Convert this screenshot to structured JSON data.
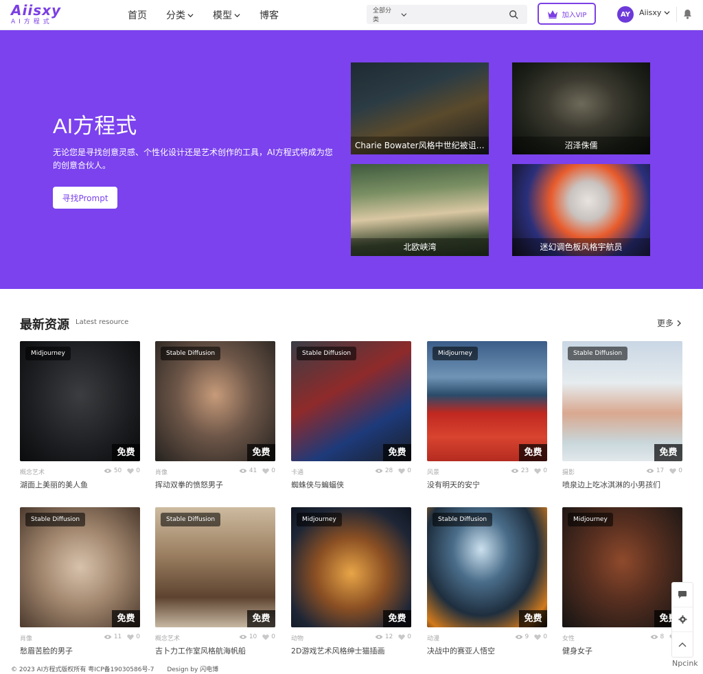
{
  "header": {
    "logo": {
      "main": "Aiisxy",
      "sub": "AI方程式"
    },
    "nav": [
      {
        "label": "首页",
        "has_dropdown": false
      },
      {
        "label": "分类",
        "has_dropdown": true
      },
      {
        "label": "模型",
        "has_dropdown": true
      },
      {
        "label": "博客",
        "has_dropdown": false
      }
    ],
    "search": {
      "category": "全部分类",
      "placeholder": ""
    },
    "vip_label": "加入VIP",
    "avatar_text": "AY",
    "username": "Aiisxy"
  },
  "hero": {
    "title": "AI方程式",
    "description": "无论您是寻找创意灵感、个性化设计还是艺术创作的工具，AI方程式将成为您的创意合伙人。",
    "button": "寻找Prompt",
    "features": [
      {
        "caption": "Charie Bowater风格中世纪被诅咒的哥特小镇"
      },
      {
        "caption": "沼泽侏儒"
      },
      {
        "caption": "北欧峡湾"
      },
      {
        "caption": "迷幻调色板风格宇航员"
      }
    ]
  },
  "latest": {
    "title": "最新资源",
    "subtitle": "Latest resource",
    "more": "更多",
    "cards": [
      {
        "tag": "Midjourney",
        "badge": "免费",
        "category": "概念艺术",
        "views": "50",
        "likes": "0",
        "title": "湖面上美丽的美人鱼"
      },
      {
        "tag": "Stable Diffusion",
        "badge": "免费",
        "category": "肖像",
        "views": "41",
        "likes": "0",
        "title": "挥动双拳的愤怒男子"
      },
      {
        "tag": "Stable Diffusion",
        "badge": "免费",
        "category": "卡通",
        "views": "28",
        "likes": "0",
        "title": "蜘蛛侠与蝙蝠侠"
      },
      {
        "tag": "Midjourney",
        "badge": "免费",
        "category": "风景",
        "views": "23",
        "likes": "0",
        "title": "没有明天的安宁"
      },
      {
        "tag": "Stable Diffusion",
        "badge": "免费",
        "category": "摄影",
        "views": "17",
        "likes": "0",
        "title": "喷泉边上吃冰淇淋的小男孩们"
      },
      {
        "tag": "Stable Diffusion",
        "badge": "免费",
        "category": "肖像",
        "views": "11",
        "likes": "0",
        "title": "愁眉苦脸的男子"
      },
      {
        "tag": "Stable Diffusion",
        "badge": "免费",
        "category": "概念艺术",
        "views": "10",
        "likes": "0",
        "title": "吉卜力工作室风格航海帆船"
      },
      {
        "tag": "Midjourney",
        "badge": "免费",
        "category": "动物",
        "views": "12",
        "likes": "0",
        "title": "2D游戏艺术风格绅士猫插画"
      },
      {
        "tag": "Stable Diffusion",
        "badge": "免费",
        "category": "动漫",
        "views": "9",
        "likes": "0",
        "title": "决战中的赛亚人悟空"
      },
      {
        "tag": "Midjourney",
        "badge": "免费",
        "category": "女性",
        "views": "8",
        "likes": "0",
        "title": "健身女子"
      }
    ]
  },
  "footer": {
    "copyright": "© 2023 AI方程式版权所有 粤ICP备19030586号-7",
    "design": "Design by 闪电博"
  },
  "watermark": "Npcink",
  "colors": {
    "brand": "#7b42ee",
    "accent": "#7b3fe4"
  }
}
